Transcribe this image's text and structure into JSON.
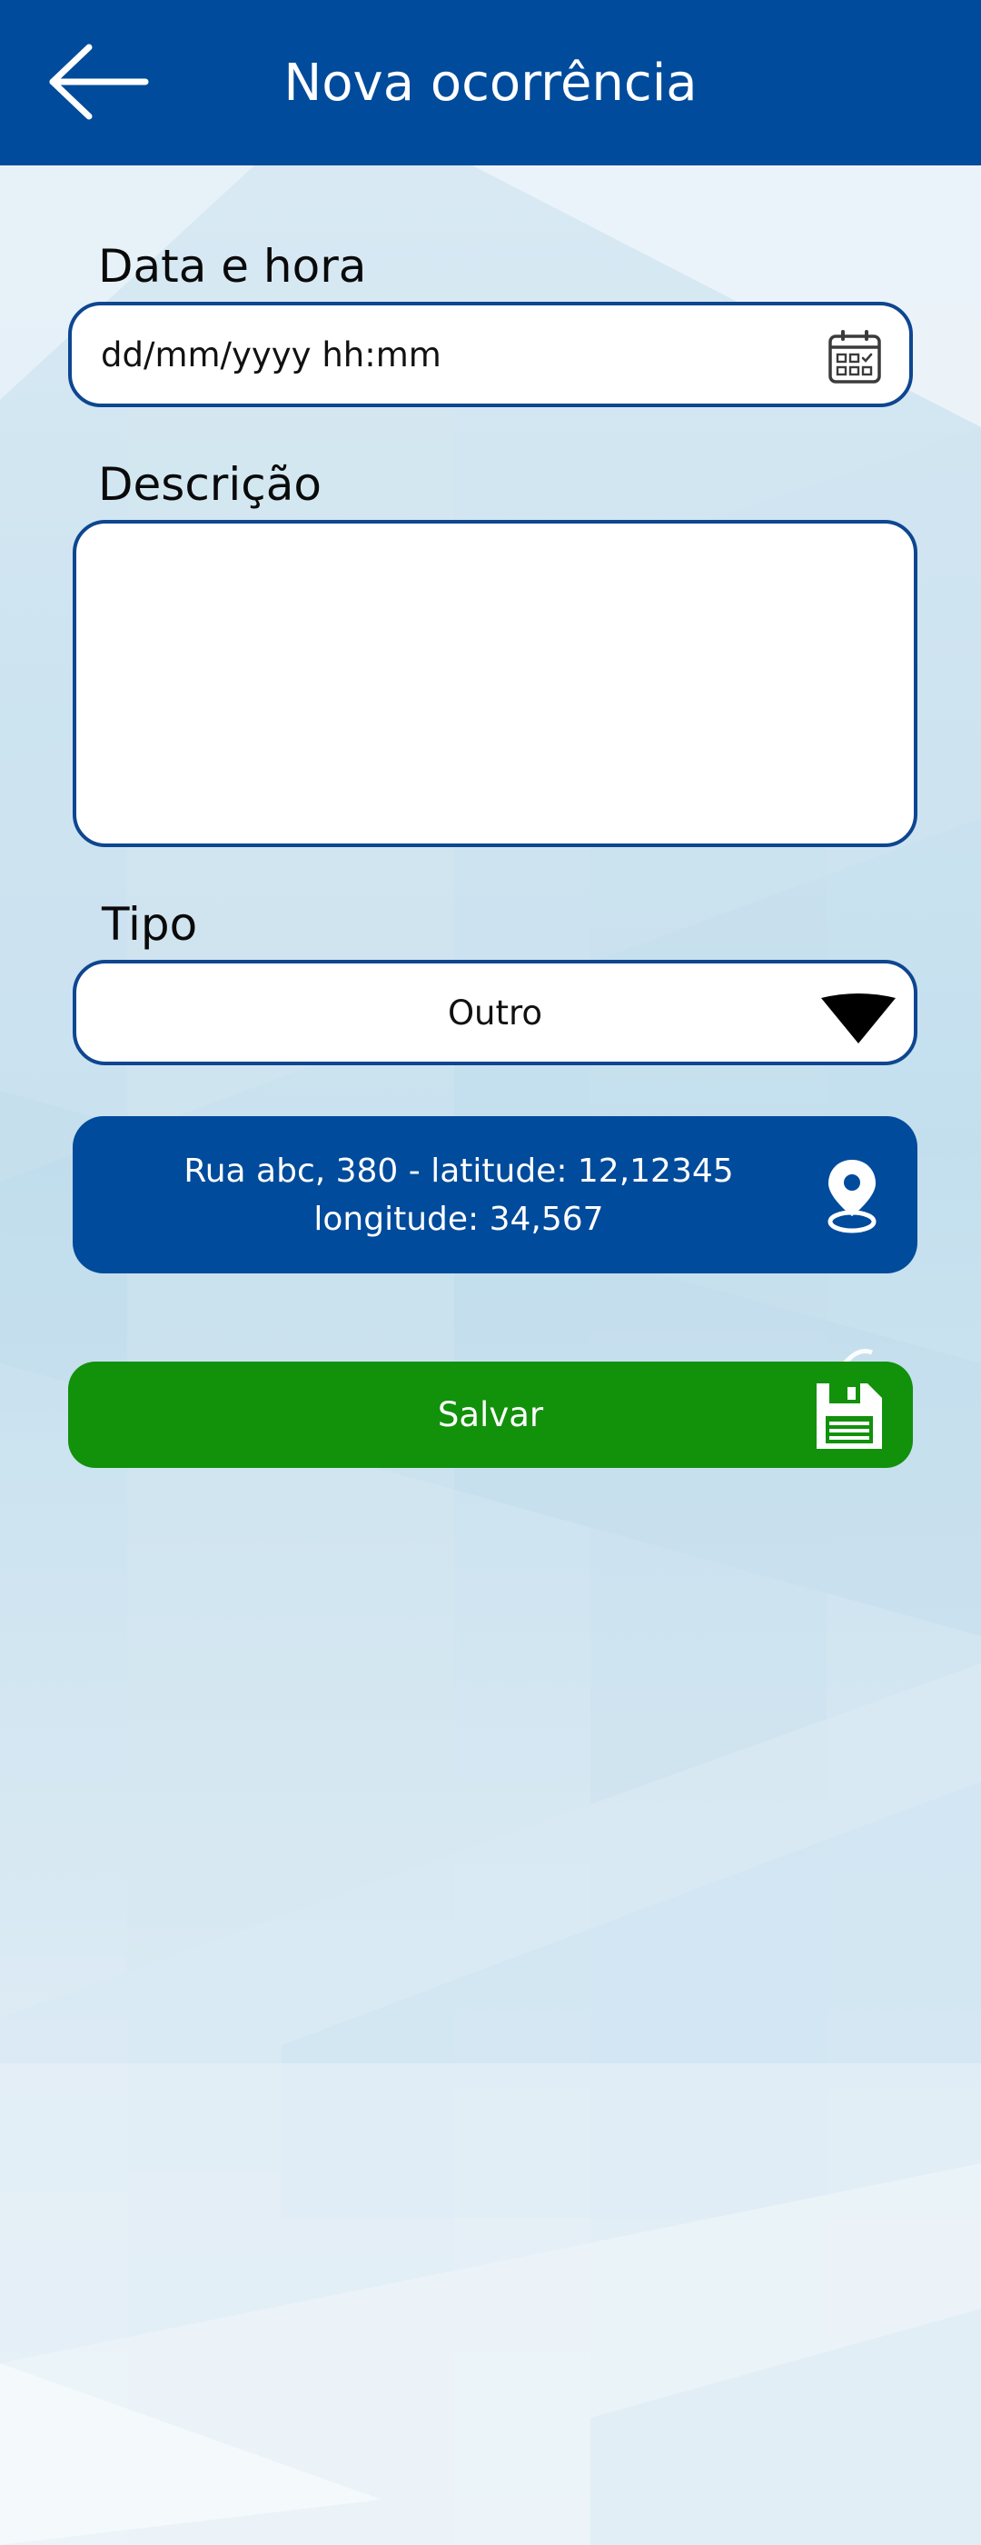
{
  "header": {
    "title": "Nova ocorrência",
    "back_icon": "arrow-left-icon"
  },
  "form": {
    "datetime": {
      "label": "Data e hora",
      "placeholder": "dd/mm/yyyy hh:mm",
      "icon": "calendar-icon"
    },
    "description": {
      "label": "Descrição",
      "value": ""
    },
    "type": {
      "label": "Tipo",
      "selected": "Outro",
      "icon": "chevron-down-icon"
    },
    "location": {
      "line1": "Rua abc, 380 - latitude: 12,12345",
      "line2": "longitude: 34,567",
      "icon": "map-pin-icon"
    },
    "save": {
      "label": "Salvar",
      "icon": "floppy-disk-icon"
    }
  },
  "colors": {
    "primary": "#004b9b",
    "border": "#0e4690",
    "save": "#12910b",
    "background": "#d3e6f1"
  }
}
